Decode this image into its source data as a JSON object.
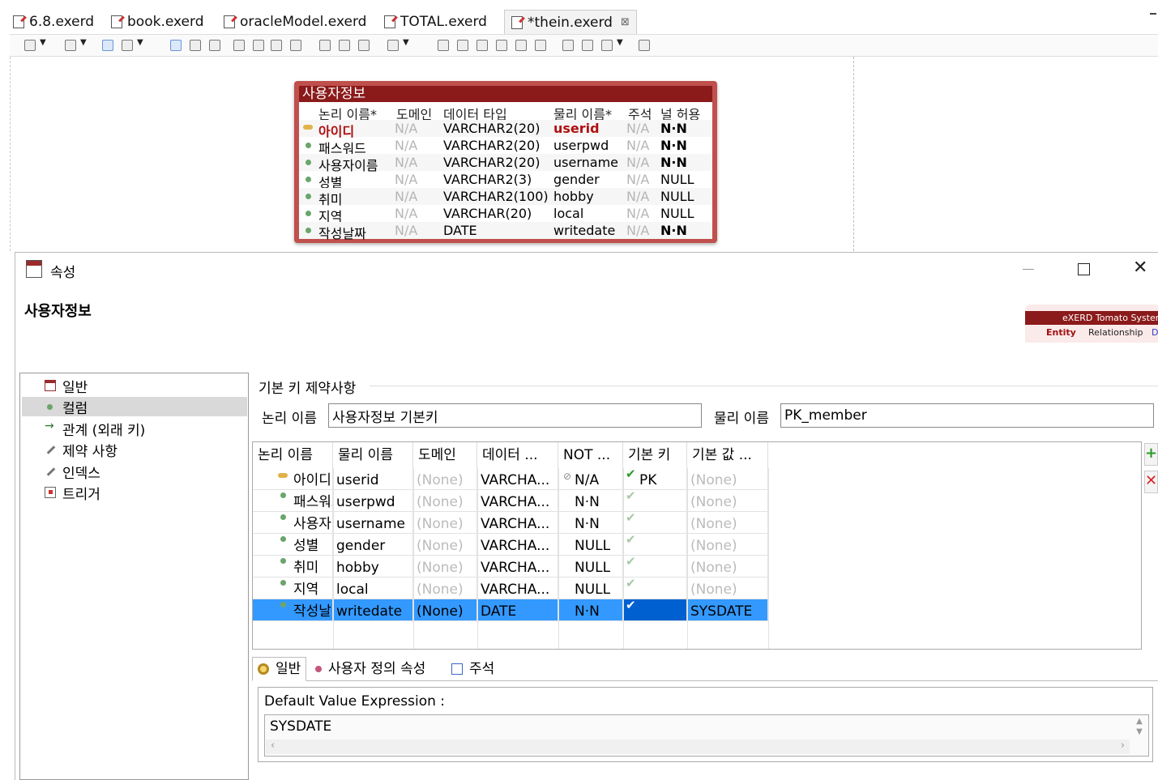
{
  "tabs": [
    {
      "label": "6.8.exerd",
      "active": false
    },
    {
      "label": "book.exerd",
      "active": false
    },
    {
      "label": "oracleModel.exerd",
      "active": false
    },
    {
      "label": "TOTAL.exerd",
      "active": false
    },
    {
      "label": "*thein.exerd",
      "active": true,
      "close": "⊠"
    }
  ],
  "entity": {
    "title": "사용자정보",
    "headers": [
      "논리 이름*",
      "도메인",
      "데이터 타입",
      "물리 이름*",
      "주석",
      "널 허용"
    ],
    "rows": [
      {
        "logical": "아이디",
        "domain": "N/A",
        "type": "VARCHAR2(20)",
        "physical": "userid",
        "comment": "N/A",
        "nullable": "N·N",
        "pk": true
      },
      {
        "logical": "패스워드",
        "domain": "N/A",
        "type": "VARCHAR2(20)",
        "physical": "userpwd",
        "comment": "N/A",
        "nullable": "N·N",
        "pk": false
      },
      {
        "logical": "사용자이름",
        "domain": "N/A",
        "type": "VARCHAR2(20)",
        "physical": "username",
        "comment": "N/A",
        "nullable": "N·N",
        "pk": false
      },
      {
        "logical": "성별",
        "domain": "N/A",
        "type": "VARCHAR2(3)",
        "physical": "gender",
        "comment": "N/A",
        "nullable": "NULL",
        "pk": false
      },
      {
        "logical": "취미",
        "domain": "N/A",
        "type": "VARCHAR2(100)",
        "physical": "hobby",
        "comment": "N/A",
        "nullable": "NULL",
        "pk": false
      },
      {
        "logical": "지역",
        "domain": "N/A",
        "type": "VARCHAR(20)",
        "physical": "local",
        "comment": "N/A",
        "nullable": "NULL",
        "pk": false
      },
      {
        "logical": "작성날짜",
        "domain": "N/A",
        "type": "DATE",
        "physical": "writedate",
        "comment": "N/A",
        "nullable": "N·N",
        "pk": false
      }
    ]
  },
  "dialog": {
    "title": "속성",
    "heading": "사용자정보",
    "banner": {
      "brand": "eXERD Tomato System",
      "entity": "Entity",
      "relationship": "Relationship",
      "d": "D"
    },
    "nav": [
      "일반",
      "컬럼",
      "관계 (외래 키)",
      "제약 사항",
      "인덱스",
      "트리거"
    ],
    "pk_section": "기본 키 제약사항",
    "logical_label": "논리 이름",
    "logical_value": "사용자정보 기본키",
    "physical_label": "물리 이름",
    "physical_value": "PK_member",
    "columns": {
      "headers": [
        "논리 이름",
        "물리 이름",
        "도메인",
        "데이터 ...",
        "NOT ...",
        "기본 키",
        "기본 값 ..."
      ],
      "rows": [
        {
          "logical": "아이디",
          "physical": "userid",
          "domain": "(None)",
          "type": "VARCHA...",
          "notnull": "N/A",
          "pk": "PK",
          "default": "(None)",
          "key": true
        },
        {
          "logical": "패스워드",
          "physical": "userpwd",
          "domain": "(None)",
          "type": "VARCHA...",
          "notnull": "N·N",
          "pk": "",
          "default": "(None)"
        },
        {
          "logical": "사용자",
          "physical": "username",
          "domain": "(None)",
          "type": "VARCHA...",
          "notnull": "N·N",
          "pk": "",
          "default": "(None)"
        },
        {
          "logical": "성별",
          "physical": "gender",
          "domain": "(None)",
          "type": "VARCHA...",
          "notnull": "NULL",
          "pk": "",
          "default": "(None)"
        },
        {
          "logical": "취미",
          "physical": "hobby",
          "domain": "(None)",
          "type": "VARCHA...",
          "notnull": "NULL",
          "pk": "",
          "default": "(None)"
        },
        {
          "logical": "지역",
          "physical": "local",
          "domain": "(None)",
          "type": "VARCHA...",
          "notnull": "NULL",
          "pk": "",
          "default": "(None)"
        },
        {
          "logical": "작성날",
          "physical": "writedate",
          "domain": "(None)",
          "type": "DATE",
          "notnull": "N·N",
          "pk": "",
          "default": "SYSDATE",
          "selected": true
        }
      ]
    },
    "bottom_tabs": [
      "일반",
      "사용자 정의 속성",
      "주석"
    ],
    "expr_label": "Default Value Expression :",
    "expr_value": "SYSDATE"
  },
  "colors": {
    "entity_border": "#c0504d",
    "entity_title": "#8b1a1a",
    "selection": "#3399ff"
  }
}
